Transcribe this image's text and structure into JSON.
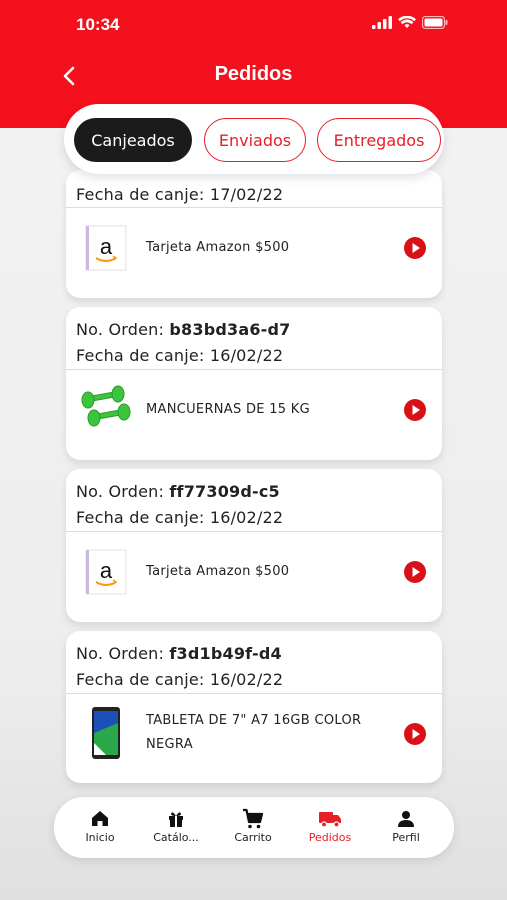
{
  "status_bar": {
    "time": "10:34"
  },
  "header": {
    "title": "Pedidos",
    "accent": "#f4101c"
  },
  "tabs": [
    {
      "label": "Canjeados",
      "active": true
    },
    {
      "label": "Enviados",
      "active": false
    },
    {
      "label": "Entregados",
      "active": false
    }
  ],
  "orders": [
    {
      "date_label": "Fecha de canje:",
      "date": "17/02/22",
      "product": "Tarjeta Amazon $500",
      "image": "amazon-card-icon"
    },
    {
      "order_label": "No. Orden:",
      "order_id": "b83bd3a6-d7",
      "date_label": "Fecha de canje:",
      "date": "16/02/22",
      "product": "MANCUERNAS DE 15 KG",
      "image": "dumbbells-icon"
    },
    {
      "order_label": "No. Orden:",
      "order_id": "ff77309d-c5",
      "date_label": "Fecha de canje:",
      "date": "16/02/22",
      "product": "Tarjeta Amazon $500",
      "image": "amazon-card-icon"
    },
    {
      "order_label": "No. Orden:",
      "order_id": "f3d1b49f-d4",
      "date_label": "Fecha de canje:",
      "date": "16/02/22",
      "product_line1": "TABLETA DE 7\" A7  16GB COLOR",
      "product_line2": "NEGRA",
      "image": "tablet-icon"
    }
  ],
  "bottom_nav": [
    {
      "label": "Inicio",
      "icon": "home-icon",
      "active": false
    },
    {
      "label": "Catálo...",
      "icon": "gift-icon",
      "active": false
    },
    {
      "label": "Carrito",
      "icon": "cart-icon",
      "active": false
    },
    {
      "label": "Pedidos",
      "icon": "truck-icon",
      "active": true
    },
    {
      "label": "Perfil",
      "icon": "user-icon",
      "active": false
    }
  ]
}
